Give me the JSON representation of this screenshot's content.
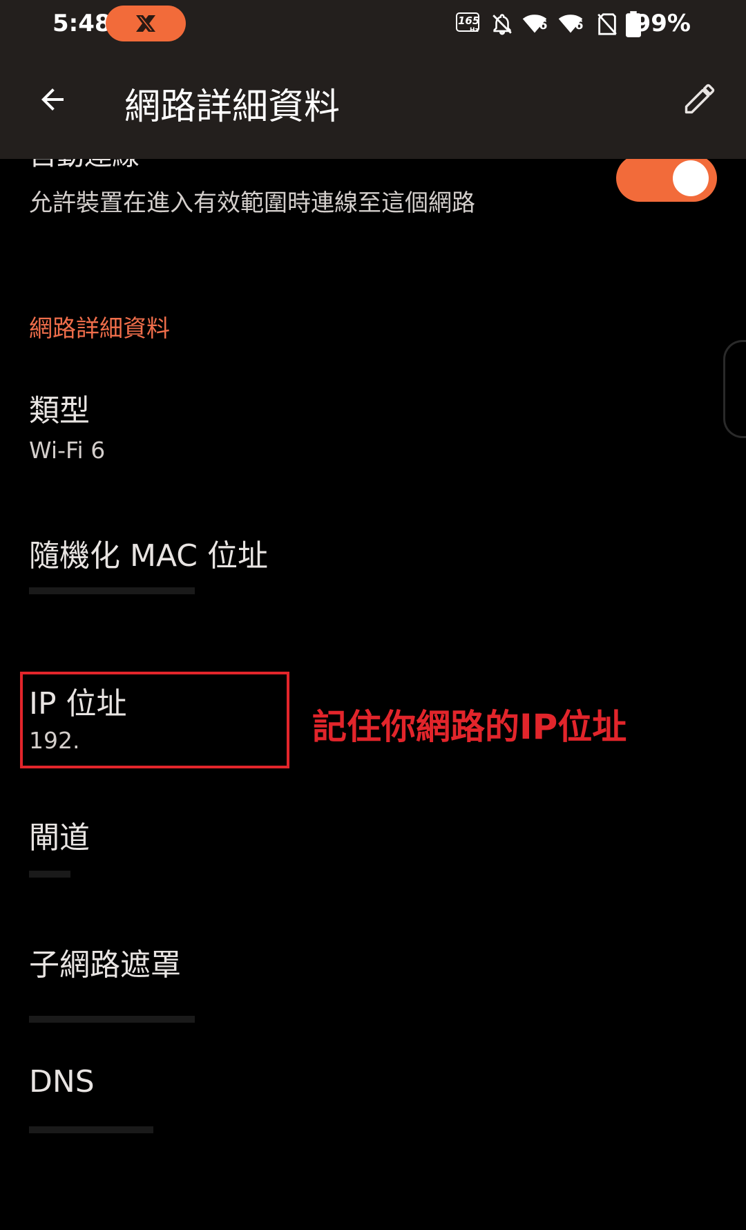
{
  "status_bar": {
    "time": "5:48",
    "notification_icon": "x-app-icon",
    "refresh_rate": "165",
    "refresh_unit": "Hz",
    "wifi_badge_1": "6",
    "wifi_badge_2": "6",
    "battery": "99%"
  },
  "app_bar": {
    "title": "網路詳細資料",
    "back_icon": "arrow-back-icon",
    "edit_icon": "pencil-edit-icon"
  },
  "auto_connect": {
    "title": "自動連線",
    "summary": "允許裝置在進入有效範圍時連線至這個網路",
    "toggle_on": true
  },
  "section_header": "網路詳細資料",
  "details": [
    {
      "title": "類型",
      "summary": "Wi-Fi 6"
    },
    {
      "title": "隨機化 MAC 位址",
      "summary": ""
    },
    {
      "title": "IP 位址",
      "summary": "192."
    },
    {
      "title": "閘道",
      "summary": ""
    },
    {
      "title": "子網路遮罩",
      "summary": ""
    },
    {
      "title": "DNS",
      "summary": ""
    }
  ],
  "annotation": "記住你網路的IP位址",
  "colors": {
    "accent": "#f26b3a",
    "section_header": "#f06e4b",
    "annotation_red": "#e2252b",
    "app_bar_bg": "#231f1d",
    "background": "#000000"
  }
}
